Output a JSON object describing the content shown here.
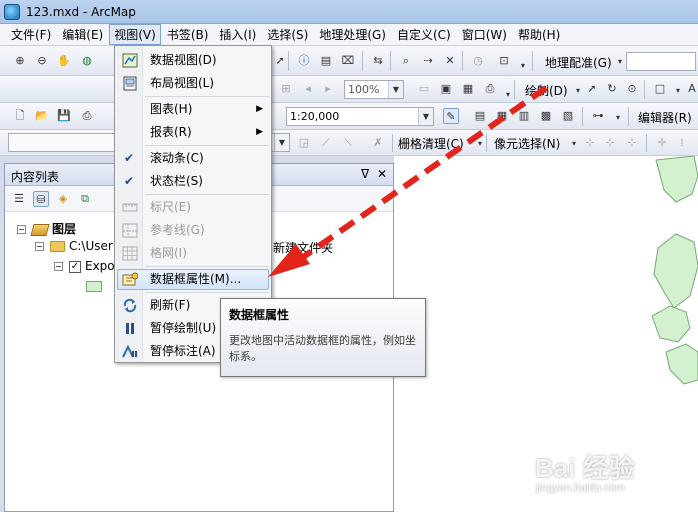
{
  "window": {
    "title": "123.mxd - ArcMap"
  },
  "menubar": {
    "items": [
      "文件(F)",
      "编辑(E)",
      "视图(V)",
      "书签(B)",
      "插入(I)",
      "选择(S)",
      "地理处理(G)",
      "自定义(C)",
      "窗口(W)",
      "帮助(H)"
    ]
  },
  "toolbar": {
    "georef_label": "地理配准(G)",
    "zoom_combo": "100%",
    "draw_label": "绘制(D)",
    "scale_value": "1:20,000",
    "editor_label": "编辑器(R)",
    "raster_clean_label": "栅格清理(C)",
    "pixel_select_label": "像元选择(N)"
  },
  "toc": {
    "title": "内容列表",
    "pin": "ᐁ",
    "close": "✕",
    "layers_label": "图层",
    "folder_label": "C:\\User",
    "folder_label_tail": "新建文件夹",
    "layer_label": "Expo"
  },
  "view_menu": {
    "items": [
      {
        "label": "数据视图(D)",
        "icon": "data-view-icon"
      },
      {
        "label": "布局视图(L)",
        "icon": "layout-view-icon"
      },
      {
        "label": "图表(H)",
        "submenu": true
      },
      {
        "label": "报表(R)",
        "submenu": true
      },
      {
        "label": "滚动条(C)",
        "checked": true
      },
      {
        "label": "状态栏(S)",
        "checked": true
      },
      {
        "label": "标尺(E)",
        "disabled": true,
        "icon": "ruler-icon"
      },
      {
        "label": "参考线(G)",
        "disabled": true,
        "icon": "guides-icon"
      },
      {
        "label": "格网(I)",
        "disabled": true,
        "icon": "grid-icon"
      },
      {
        "label": "数据框属性(M)...",
        "highlighted": true,
        "icon": "data-frame-properties-icon"
      },
      {
        "label": "刷新(F)",
        "icon": "refresh-icon"
      },
      {
        "label": "暂停绘制(U)",
        "icon": "pause-drawing-icon"
      },
      {
        "label": "暂停标注(A)",
        "icon": "pause-labeling-icon"
      }
    ]
  },
  "tooltip": {
    "title": "数据框属性",
    "body": "更改地图中活动数据框的属性，例如坐标系。"
  },
  "watermark": {
    "brand": "Bai 经验",
    "url": "jingyan.baidu.com"
  },
  "colors": {
    "arrow": "#e3241b",
    "map_polygon_fill": "#d3f0cf",
    "map_polygon_stroke": "#7aa578",
    "menu_highlight": "#d3e4fa"
  }
}
